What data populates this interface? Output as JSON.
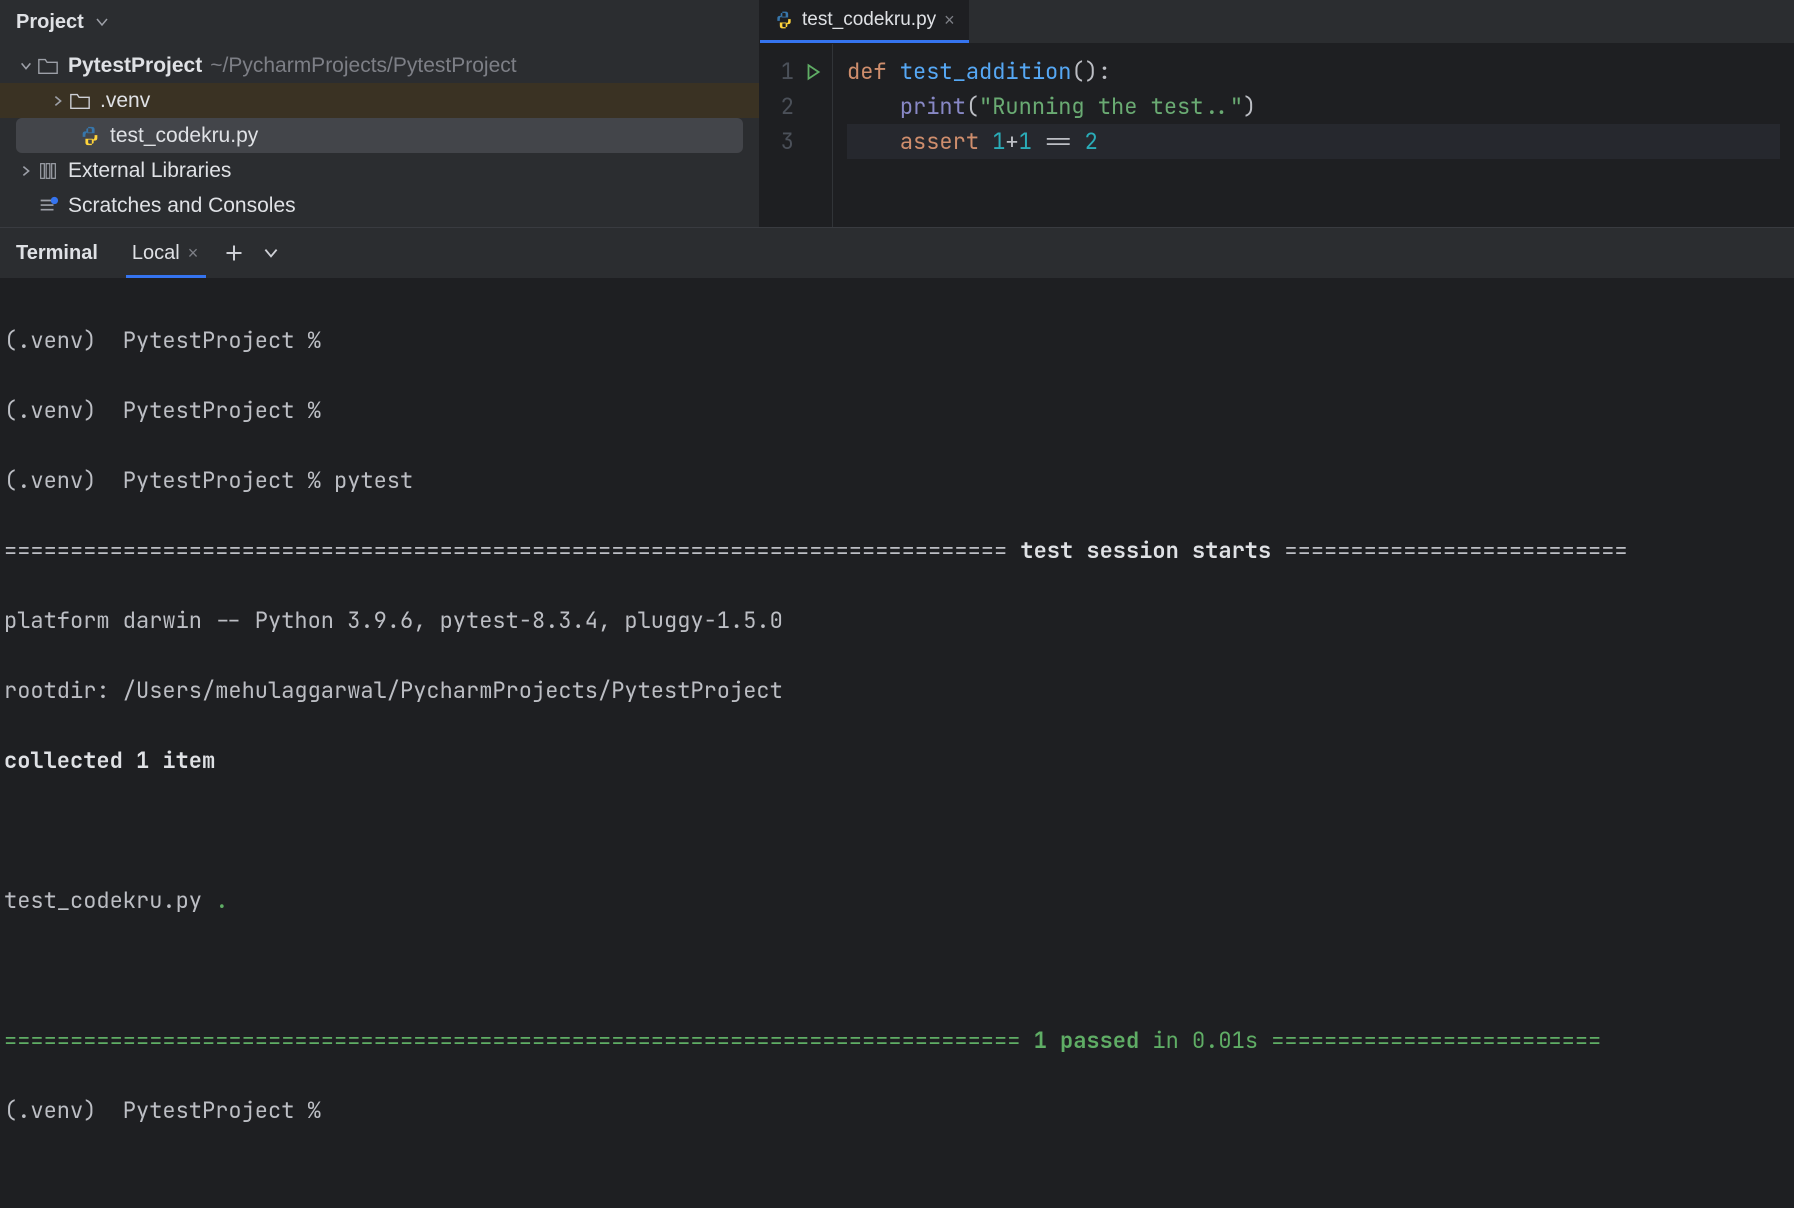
{
  "project_panel": {
    "title": "Project",
    "tree": {
      "root": {
        "name": "PytestProject",
        "path": "~/PycharmProjects/PytestProject"
      },
      "venv": ".venv",
      "file": "test_codekru.py",
      "external": "External Libraries",
      "scratches": "Scratches and Consoles"
    }
  },
  "editor": {
    "tab": {
      "filename": "test_codekru.py"
    },
    "lines": [
      "1",
      "2",
      "3"
    ],
    "code": {
      "l1_def": "def ",
      "l1_fn": "test_addition",
      "l1_rest": "():",
      "l2_indent": "    ",
      "l2_print": "print",
      "l2_open": "(",
      "l2_str": "\"Running the test..\"",
      "l2_close": ")",
      "l3_indent": "    ",
      "l3_assert": "assert ",
      "l3_n1": "1",
      "l3_plus": "+",
      "l3_n2": "1 ",
      "l3_eq": "== ",
      "l3_n3": "2"
    }
  },
  "terminal": {
    "title": "Terminal",
    "tab_label": "Local",
    "lines": {
      "p1": "(.venv)  PytestProject % ",
      "p2": "(.venv)  PytestProject % ",
      "p3": "(.venv)  PytestProject % pytest",
      "sep1_left": "============================================================================ ",
      "sep1_mid": "test session starts",
      "sep1_right": " ==========================",
      "platform": "platform darwin -- Python 3.9.6, pytest-8.3.4, pluggy-1.5.0",
      "rootdir": "rootdir: /Users/mehulaggarwal/PycharmProjects/PytestProject",
      "collected": "collected 1 item",
      "blank": "",
      "testfile": "test_codekru.py ",
      "dot": ".",
      "sep2_left": "============================================================================= ",
      "sep2_mid": "1 passed",
      "sep2_in": " in 0.01s",
      "sep2_right": " =========================",
      "p4": "(.venv)  PytestProject % "
    }
  }
}
